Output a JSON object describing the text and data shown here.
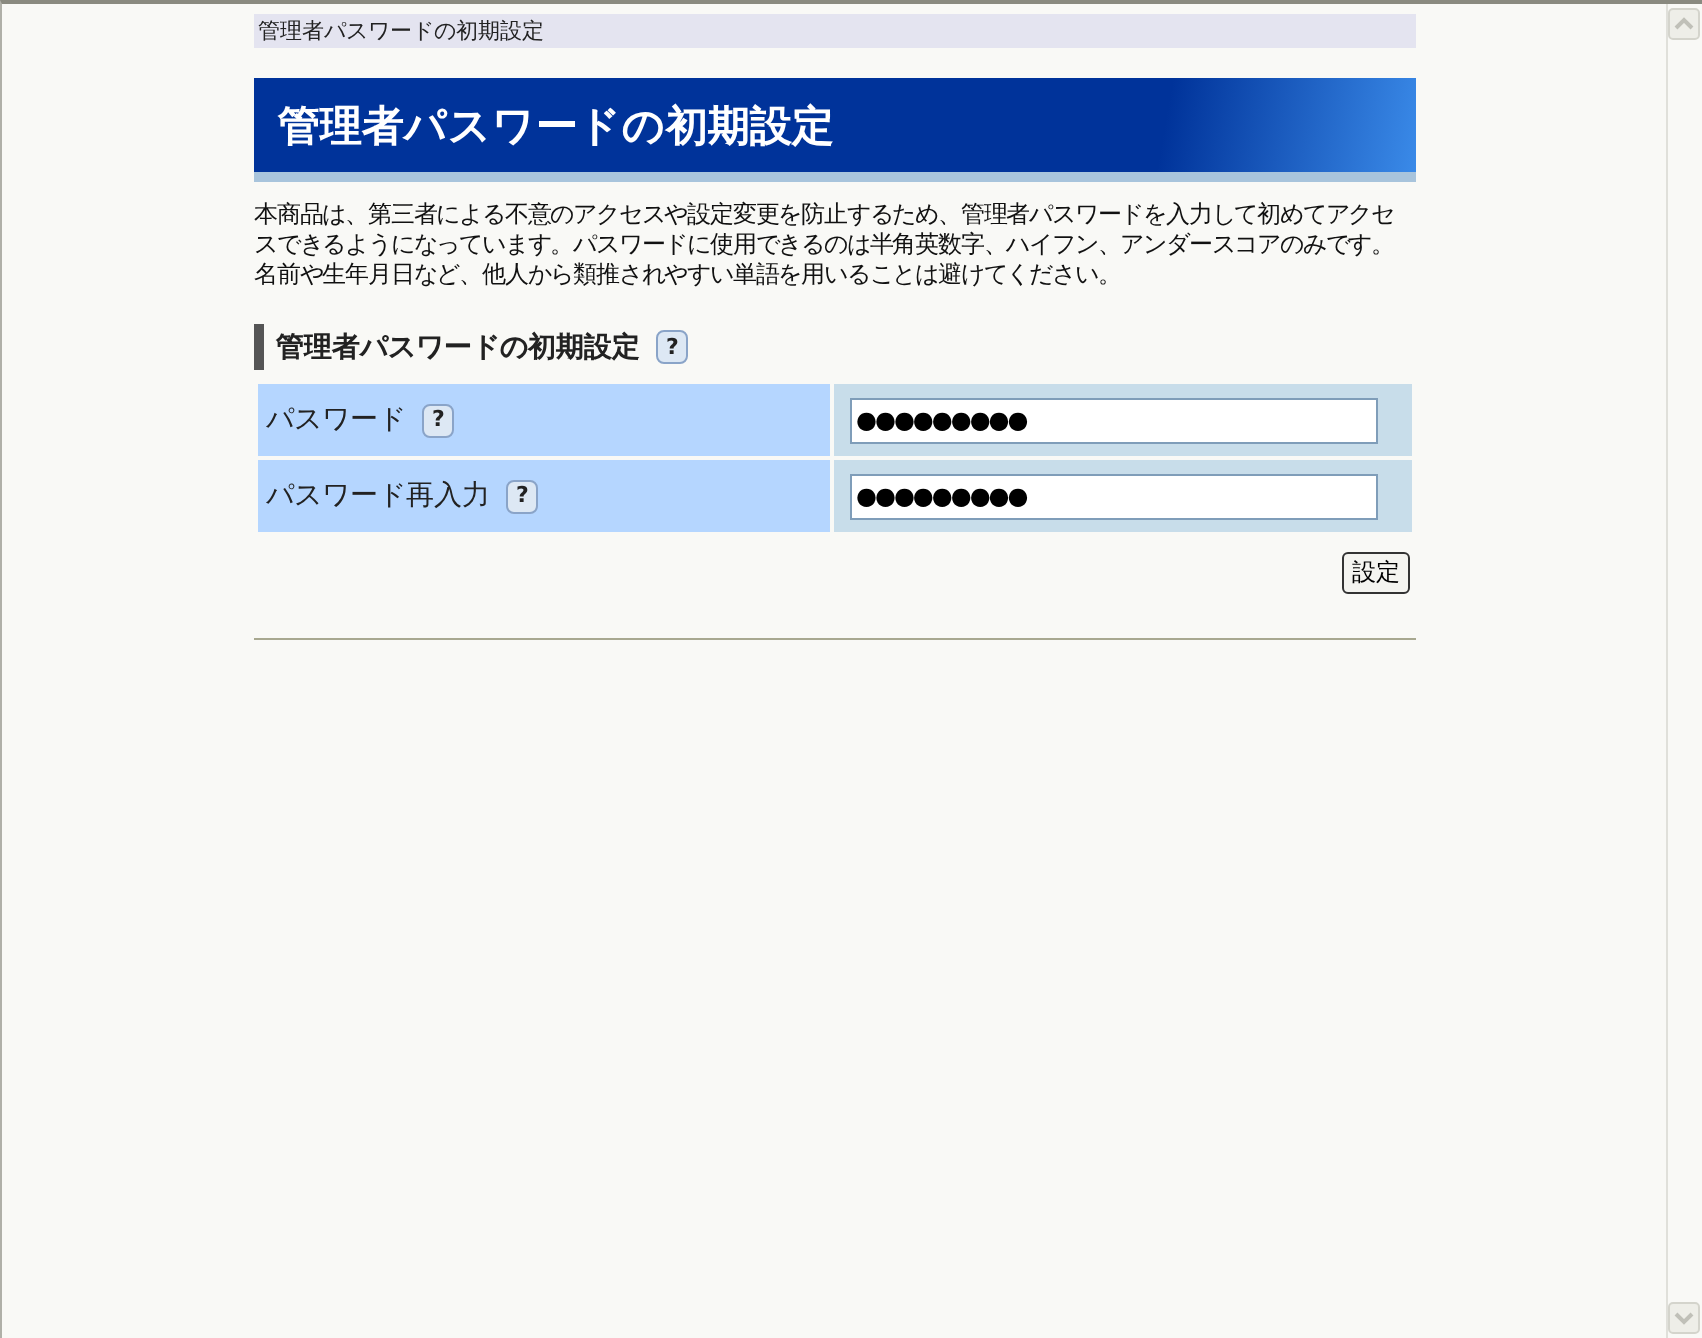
{
  "breadcrumb": "管理者パスワードの初期設定",
  "title": "管理者パスワードの初期設定",
  "description": "本商品は、第三者による不意のアクセスや設定変更を防止するため、管理者パスワードを入力して初めてアクセスできるようになっています。パスワードに使用できるのは半角英数字、ハイフン、アンダースコアのみです。名前や生年月日など、他人から類推されやすい単語を用いることは避けてください。",
  "section": {
    "heading": "管理者パスワードの初期設定",
    "help": "?"
  },
  "fields": [
    {
      "label": "パスワード",
      "help": "?",
      "value": "●●●●●●●●●"
    },
    {
      "label": "パスワード再入力",
      "help": "?",
      "value": "●●●●●●●●●"
    }
  ],
  "submit": "設定"
}
